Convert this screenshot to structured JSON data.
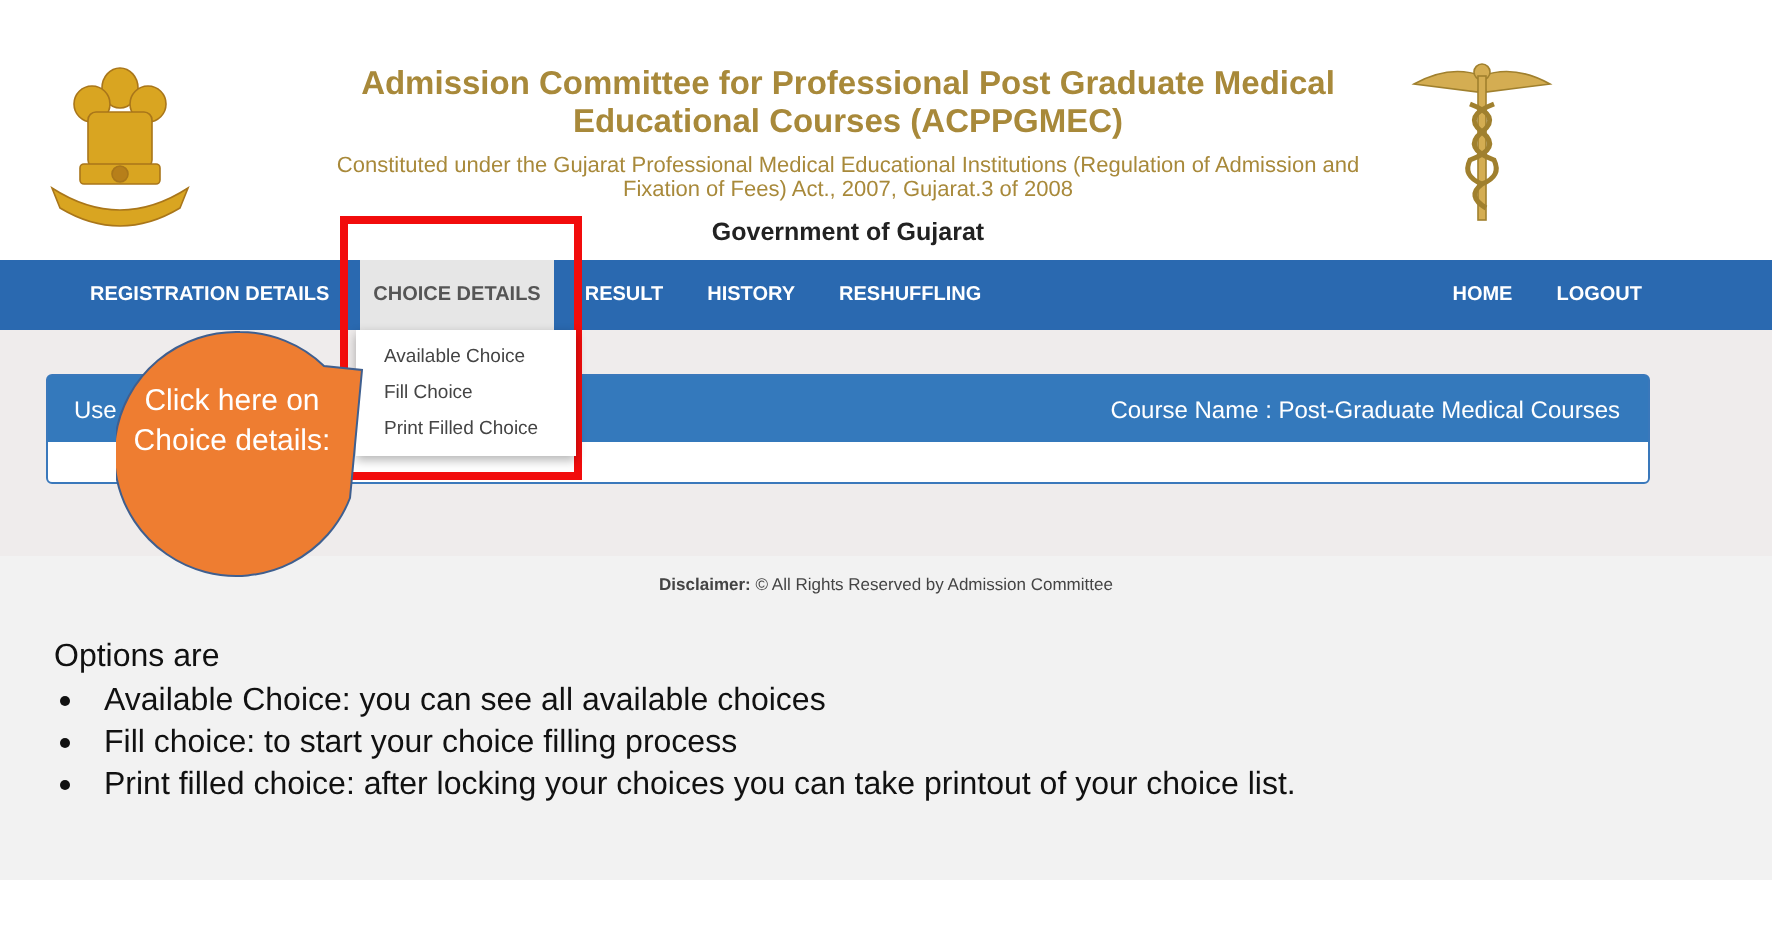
{
  "header": {
    "title": "Admission Committee for Professional Post Graduate Medical Educational Courses (ACPPGMEC)",
    "subtitle": "Constituted under the Gujarat Professional Medical Educational Institutions (Regulation of Admission and Fixation of Fees) Act., 2007, Gujarat.3 of 2008",
    "government": "Government of Gujarat"
  },
  "nav": {
    "items": [
      {
        "label": "REGISTRATION DETAILS",
        "selected": false
      },
      {
        "label": "CHOICE DETAILS",
        "selected": true
      },
      {
        "label": "RESULT",
        "selected": false
      },
      {
        "label": "HISTORY",
        "selected": false
      },
      {
        "label": "RESHUFFLING",
        "selected": false
      }
    ],
    "right_items": [
      {
        "label": "HOME",
        "selected": false
      },
      {
        "label": "LOGOUT",
        "selected": false
      }
    ]
  },
  "dropdown": {
    "items": [
      "Available Choice",
      "Fill Choice",
      "Print Filled Choice"
    ]
  },
  "panel": {
    "header_left": "Use",
    "course_name": "Course Name : Post-Graduate Medical Courses"
  },
  "callout": {
    "text": "Click here on Choice details:"
  },
  "footer": {
    "disclaimer": "**Disclaimer:** © All Rights Reserved by Admission Committee"
  },
  "notes": {
    "heading": "Options are",
    "bullets": [
      "Available Choice: you can see all available choices",
      "Fill choice: to start your choice filling process",
      "Print filled choice: after locking your choices you can take printout of your choice list."
    ]
  }
}
